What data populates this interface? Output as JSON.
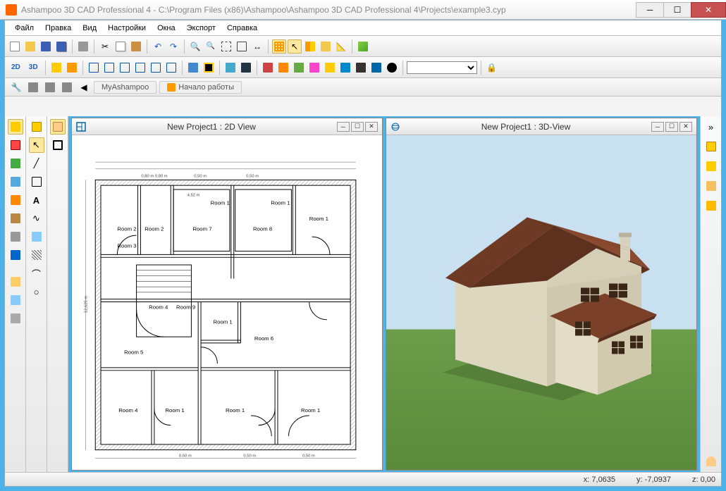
{
  "title": "Ashampoo 3D CAD Professional 4 - C:\\Program Files (x86)\\Ashampoo\\Ashampoo 3D CAD Professional 4\\Projects\\example3.cyp",
  "menu": {
    "file": "Файл",
    "edit": "Правка",
    "view": "Вид",
    "settings": "Настройки",
    "windows": "Окна",
    "export": "Экспорт",
    "help": "Справка"
  },
  "ribbon": {
    "myashampoo": "MyAshampoo",
    "start": "Начало работы"
  },
  "toolbar2": {
    "mode2d": "2D",
    "mode3d": "3D"
  },
  "view2d": {
    "title": "New Project1 : 2D View",
    "rooms": {
      "r1": "Room 1",
      "r1b": "Room 1",
      "r1c": "Room 1",
      "r2": "Room 2",
      "r22": "Room 2",
      "r3": "Room 3",
      "r4": "Room 4",
      "r4b": "Room 4",
      "r5": "Room 5",
      "r6": "Room 6",
      "r7": "Room 7",
      "r8": "Room 8",
      "r9": "Room 9"
    },
    "dims": {
      "d1": "0,50 m",
      "d2": "0,50 m",
      "d3": "0,50 m",
      "d4": "0,50 m",
      "d5": "0,50 m",
      "d6": "4,52 m",
      "d7": "12,625 m",
      "d8": "0,80 m 0,80 m"
    }
  },
  "view3d": {
    "title": "New Project1 : 3D-View"
  },
  "status": {
    "x": "x: 7,0635",
    "y": "y: -7,0937",
    "z": "z: 0,00"
  }
}
